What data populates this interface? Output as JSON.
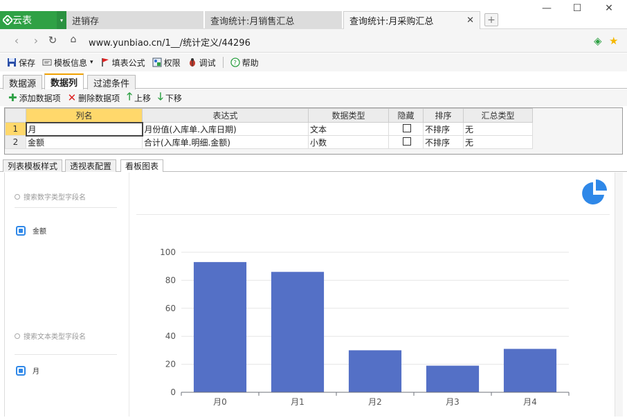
{
  "app": {
    "brand": "云表",
    "tabs": [
      {
        "label": "进销存",
        "active": false
      },
      {
        "label": "查询统计:月销售汇总",
        "active": false
      },
      {
        "label": "查询统计:月采购汇总",
        "active": true
      }
    ],
    "new_tab_icon": "plus-icon",
    "url": "www.yunbiao.cn/1__/统计定义/44296"
  },
  "toolbar": {
    "save": "保存",
    "template_info": "模板信息",
    "formula": "填表公式",
    "permission": "权限",
    "debug": "调试",
    "help": "帮助"
  },
  "subtabs": [
    "数据源",
    "数据列",
    "过滤条件"
  ],
  "actions": {
    "add": "添加数据项",
    "delete": "删除数据项",
    "up": "上移",
    "down": "下移"
  },
  "grid": {
    "headers": [
      "列名",
      "表达式",
      "数据类型",
      "隐藏",
      "排序",
      "汇总类型"
    ],
    "rows": [
      {
        "n": "1",
        "name": "月",
        "expr": "月份值(入库单.入库日期)",
        "type": "文本",
        "hidden": false,
        "sort": "不排序",
        "agg": "无"
      },
      {
        "n": "2",
        "name": "金额",
        "expr": "合计(入库单.明细.金额)",
        "type": "小数",
        "hidden": false,
        "sort": "不排序",
        "agg": "无"
      }
    ]
  },
  "bottom_tabs": [
    "列表模板样式",
    "透视表配置",
    "看板图表"
  ],
  "side": {
    "numeric_search_placeholder": "搜索数字类型字段名",
    "numeric_field": "金额",
    "text_search_placeholder": "搜索文本类型字段名",
    "text_field": "月"
  },
  "chart_data": {
    "type": "bar",
    "categories": [
      "月0",
      "月1",
      "月2",
      "月3",
      "月4"
    ],
    "values": [
      93,
      86,
      30,
      19,
      31
    ],
    "ylim": [
      0,
      100
    ],
    "yticks": [
      0,
      20,
      40,
      60,
      80,
      100
    ],
    "color": "#5470c6",
    "grid": true
  }
}
